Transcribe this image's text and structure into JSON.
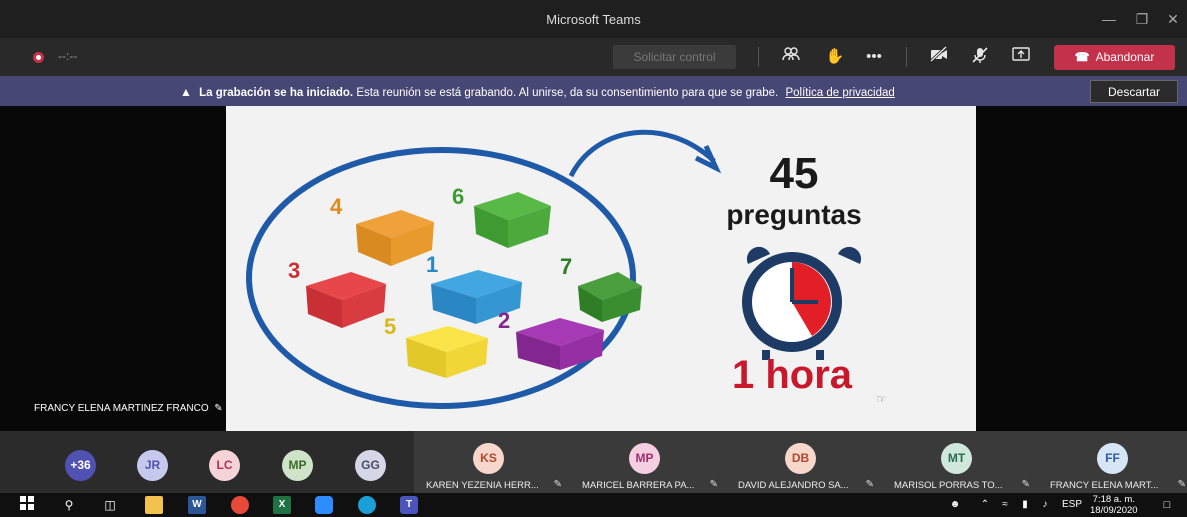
{
  "window": {
    "title": "Microsoft Teams",
    "minimize_icon": "minimize-icon",
    "restore_icon": "restore-icon",
    "close_icon": "close-icon"
  },
  "meeting_bar": {
    "timer": "--:--",
    "request_control_label": "Solicitar control",
    "leave_label": "Abandonar",
    "leave_color": "#c4314b"
  },
  "banner": {
    "title": "La grabación se ha iniciado.",
    "message": "Esta reunión se está grabando. Al unirse, da su consentimiento para que se grabe.",
    "link": "Política de privacidad",
    "dismiss_label": "Descartar",
    "background": "#464775"
  },
  "slide": {
    "count": "45",
    "questions_label": "preguntas",
    "time_label": "1 hora",
    "box_numbers": [
      "4",
      "6",
      "3",
      "1",
      "7",
      "5",
      "2"
    ]
  },
  "stage": {
    "speaker_name": "FRANCY ELENA MARTINEZ FRANCO"
  },
  "participants": {
    "small_avatars": [
      {
        "initials": "+36",
        "bg": "#4f52b2",
        "fg": "#ffffff"
      },
      {
        "initials": "JR",
        "bg": "#c7c9ec",
        "fg": "#4f52b2"
      },
      {
        "initials": "LC",
        "bg": "#f6d2d9",
        "fg": "#b3324e"
      },
      {
        "initials": "MP",
        "bg": "#cfe3c9",
        "fg": "#3b6b2a"
      },
      {
        "initials": "GG",
        "bg": "#d6d6e6",
        "fg": "#4a4a6a"
      }
    ],
    "tiles": [
      {
        "initials": "KS",
        "name": "KAREN YEZENIA HERR...",
        "bg": "#f7d6cc",
        "fg": "#b3472b"
      },
      {
        "initials": "MP",
        "name": "MARICEL BARRERA PA...",
        "bg": "#f4cfe2",
        "fg": "#a0306a"
      },
      {
        "initials": "DB",
        "name": "DAVID ALEJANDRO SA...",
        "bg": "#f7d6cc",
        "fg": "#b3472b"
      },
      {
        "initials": "MT",
        "name": "MARISOL PORRAS TO...",
        "bg": "#cfe7dc",
        "fg": "#2a6b4f"
      },
      {
        "initials": "FF",
        "name": "FRANCY ELENA MART...",
        "bg": "#d6e6f7",
        "fg": "#2a5ca3"
      }
    ]
  },
  "taskbar": {
    "language": "ESP",
    "time": "7:18 a. m.",
    "date": "18/09/2020"
  }
}
